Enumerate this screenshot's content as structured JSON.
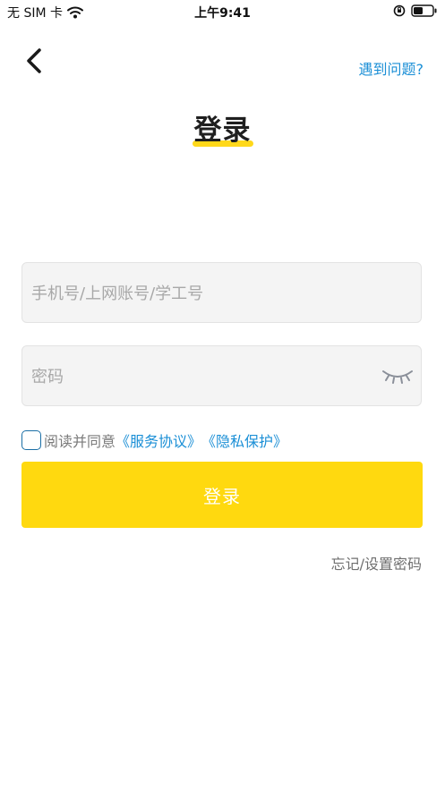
{
  "status_bar": {
    "carrier": "无 SIM 卡",
    "time": "上午9:41",
    "wifi_icon": "wifi-icon",
    "lock_icon": "rotation-lock-icon",
    "battery_icon": "battery-icon"
  },
  "header": {
    "back_icon": "chevron-left-icon",
    "help_label": "遇到问题?",
    "title": "登录",
    "accent_color": "#ffd81a"
  },
  "form": {
    "account_placeholder": "手机号/上网账号/学工号",
    "account_value": "",
    "password_placeholder": "密码",
    "password_value": "",
    "eye_icon": "eye-closed-icon"
  },
  "agreement": {
    "checked": false,
    "prefix": "阅读并同意",
    "service_link": "《服务协议》",
    "privacy_link": "《隐私保护》",
    "link_color": "#1b8fd6"
  },
  "login_button_label": "登录",
  "login_button_color": "#ffd90f",
  "forgot_label": "忘记/设置密码"
}
